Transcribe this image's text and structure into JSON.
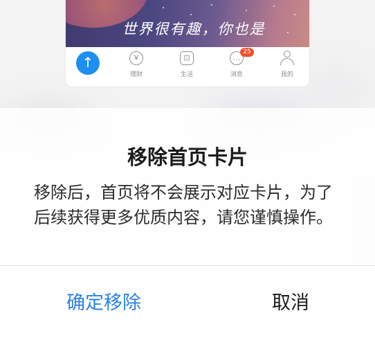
{
  "preview": {
    "banner_text": "世界很有趣，你也是",
    "nav_items": [
      {
        "label": "",
        "icon": "arrow-up-icon",
        "glyph": "↑"
      },
      {
        "label": "理财",
        "icon": "yuan-icon",
        "glyph": "¥"
      },
      {
        "label": "生活",
        "icon": "life-icon",
        "glyph": "⊡"
      },
      {
        "label": "消息",
        "icon": "message-icon",
        "glyph": "…",
        "badge": "25"
      },
      {
        "label": "我的",
        "icon": "profile-icon",
        "glyph": ""
      }
    ]
  },
  "dialog": {
    "title": "移除首页卡片",
    "message": "移除后，首页将不会展示对应卡片，为了后续获得更多优质内容，请您谨慎操作。",
    "confirm_label": "确定移除",
    "cancel_label": "取消"
  },
  "colors": {
    "accent": "#2a82e4",
    "home_button": "#1e8ff0",
    "badge": "#f0502e"
  }
}
